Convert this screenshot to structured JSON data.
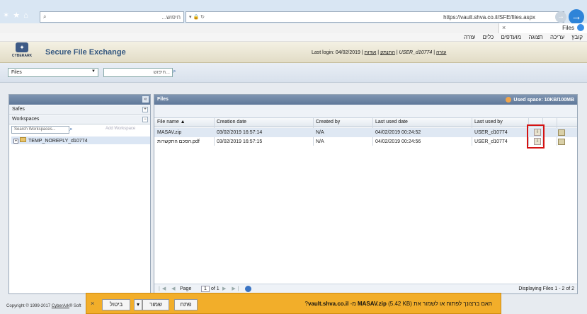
{
  "browser": {
    "url": "https://vault.shva.co.il/SFE/files.aspx",
    "search_placeholder": "...חיפוש",
    "tab_title": "Files",
    "menu": [
      "קובץ",
      "עריכה",
      "תצוגה",
      "מועדפים",
      "כלים",
      "עזרה"
    ]
  },
  "header": {
    "logo_text": "CYBERARK",
    "app_title": "Secure File Exchange",
    "last_login_label": "Last login: 04/02/2019",
    "links": [
      "התנתק",
      "אודות"
    ],
    "user": "USER_d10774",
    "help": "עזרה"
  },
  "toolbar": {
    "files_select": "Files",
    "search_placeholder": "...חיפוש"
  },
  "left_panel": {
    "safes_label": "Safes",
    "workspaces_label": "Workspaces",
    "workspace_search_placeholder": "Search Workspaces...",
    "add_workspace": "Add Workspace",
    "tree_item": "TEMP_NOREPLY_d10774"
  },
  "files_panel": {
    "title": "Files",
    "used_space": "Used space: 10KB/100MB",
    "columns": [
      "File name",
      "Creation date",
      "Created by",
      "Last used date",
      "Last used by"
    ],
    "rows": [
      {
        "name": "MASAV.zip",
        "created": "03/02/2019 16:57:14",
        "by": "N/A",
        "last_date": "04/02/2019 00:24:52",
        "last_by": "USER_d10774"
      },
      {
        "name": "הסכם התקשרות.pdf",
        "created": "03/02/2019 16:57:15",
        "by": "N/A",
        "last_date": "04/02/2019 00:24:56",
        "last_by": "USER_d10774"
      }
    ],
    "pager": {
      "page_label": "Page",
      "page_value": "1",
      "of_label": "of 1",
      "displaying": "Displaying Files 1 - 2 of 2"
    }
  },
  "footer": {
    "copyright": "Copyright © 1999-2017",
    "company": "CyberArk",
    "suffix": "® Soft"
  },
  "notification": {
    "text_prefix": "האם ברצונך לפתוח או לשמור את",
    "filename": "MASAV.zip",
    "text_suffix": "(5.42 KB) מ-",
    "host": "vault.shva.co.il",
    "question": "?",
    "open_label": "פתח",
    "save_label": "שמור",
    "cancel_label": "ביטול"
  },
  "colors": {
    "accent": "#2e84d8",
    "panel_header": "#6b82a3",
    "notification": "#f2ae2a",
    "highlight": "#d41212"
  }
}
